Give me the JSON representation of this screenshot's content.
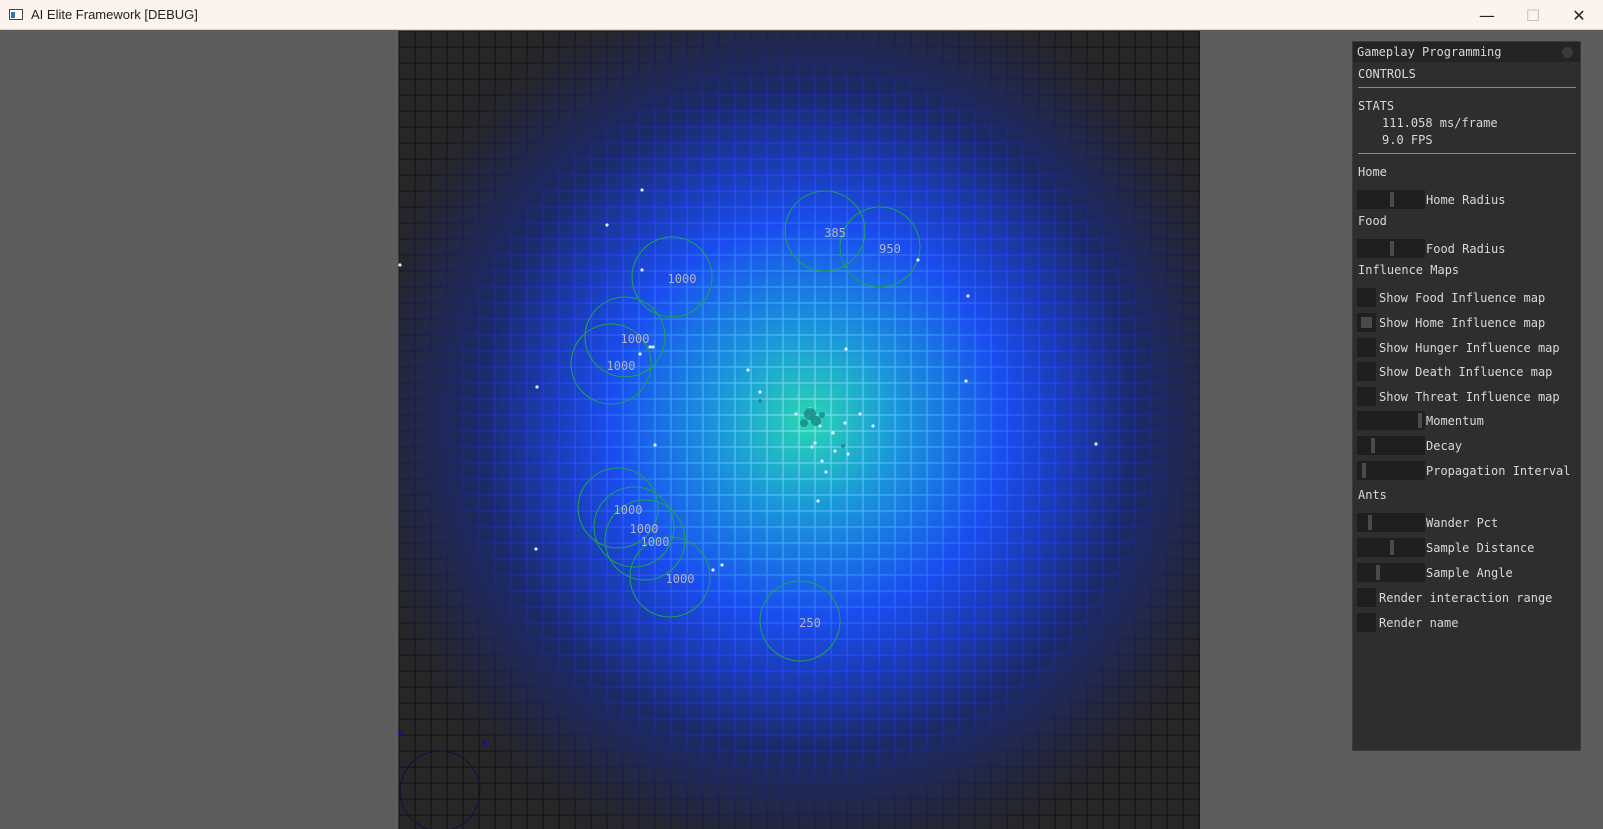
{
  "window": {
    "title": "AI Elite Framework [DEBUG]",
    "minimize_glyph": "—",
    "maximize_glyph": "☐",
    "close_glyph": "✕"
  },
  "colors": {
    "background": "#5d5d5d",
    "grid_dark": "#2a2a2a",
    "influence_core": "#2ad6b0",
    "influence_mid": "#1a4cf0",
    "range_circle": "#1aa84a",
    "home_circle": "#101040",
    "food_label": "#b4b4c4",
    "panel_bg": "#2e2e2e",
    "panel_text": "#d8d8d8"
  },
  "world": {
    "food_labels": [
      "385",
      "950",
      "1000",
      "1000",
      "1000",
      "1000",
      "1000",
      "1000",
      "1000",
      "250"
    ]
  },
  "panel": {
    "title": "Gameplay Programming",
    "controls_label": "CONTROLS",
    "stats_label": "STATS",
    "ms_per_frame": "111.058 ms/frame",
    "fps": "9.0 FPS",
    "home_header": "Home",
    "home_radius_label": "Home Radius",
    "home_radius_value": 0.5,
    "food_header": "Food",
    "food_radius_label": "Food Radius",
    "food_radius_value": 0.5,
    "influence_header": "Influence Maps",
    "show_food_label": "Show Food Influence map",
    "show_food_checked": false,
    "show_home_label": "Show Home Influence map",
    "show_home_checked": true,
    "show_hunger_label": "Show Hunger Influence map",
    "show_hunger_checked": false,
    "show_death_label": "Show Death Influence map",
    "show_death_checked": false,
    "show_threat_label": "Show Threat Influence map",
    "show_threat_checked": false,
    "momentum_label": "Momentum",
    "momentum_value": 0.95,
    "decay_label": "Decay",
    "decay_value": 0.2,
    "propagation_label": "Propagation Interval",
    "propagation_value": 0.05,
    "ants_header": "Ants",
    "wander_label": "Wander Pct",
    "wander_value": 0.15,
    "sample_distance_label": "Sample Distance",
    "sample_distance_value": 0.5,
    "sample_angle_label": "Sample Angle",
    "sample_angle_value": 0.28,
    "render_range_label": "Render interaction range",
    "render_range_checked": false,
    "render_name_label": "Render name",
    "render_name_checked": false
  }
}
